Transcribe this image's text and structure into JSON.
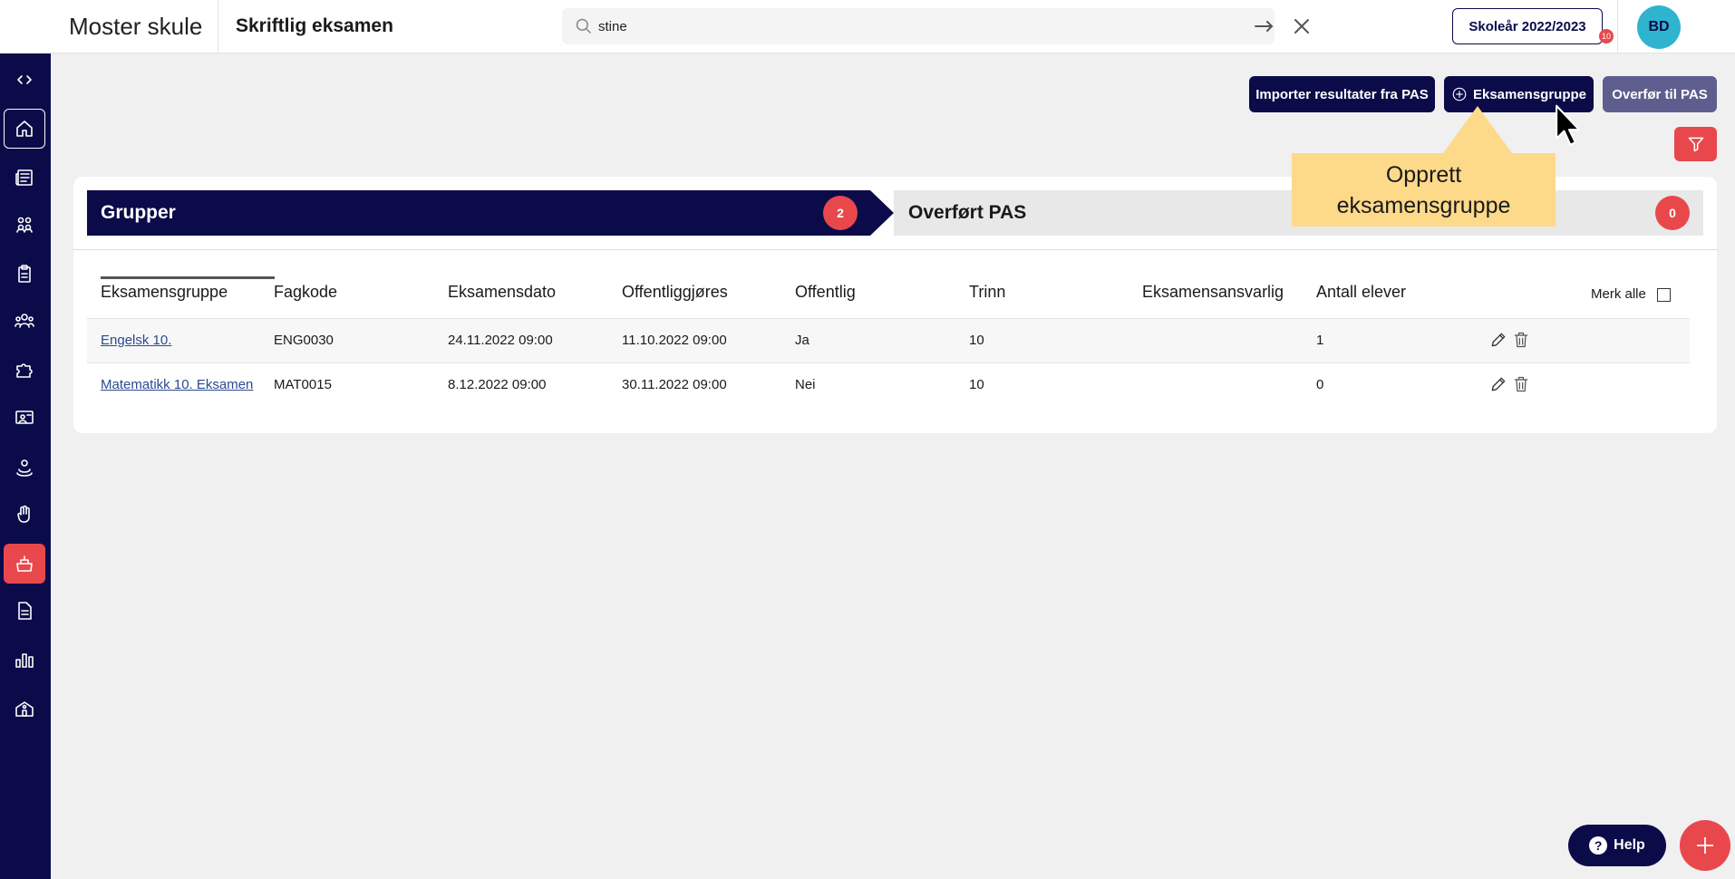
{
  "app": {
    "brand": "Moster skule",
    "page_title": "Skriftlig eksamen"
  },
  "search": {
    "value": "stine",
    "placeholder": ""
  },
  "header": {
    "school_year_label": "Skoleår 2022/2023",
    "notification_count": "10",
    "avatar_initials": "BD"
  },
  "sidebar": {
    "items": [
      {
        "icon": "collapse-toggle-icon"
      },
      {
        "icon": "home-icon"
      },
      {
        "icon": "news-icon"
      },
      {
        "icon": "groups-icon"
      },
      {
        "icon": "clipboard-icon"
      },
      {
        "icon": "people-icon"
      },
      {
        "icon": "puzzle-icon"
      },
      {
        "icon": "presentation-icon"
      },
      {
        "icon": "person-icon"
      },
      {
        "icon": "hand-icon"
      },
      {
        "icon": "exam-icon",
        "active": true
      },
      {
        "icon": "document-icon"
      },
      {
        "icon": "bar-chart-icon"
      },
      {
        "icon": "school-icon"
      }
    ]
  },
  "actions": {
    "import_label": "Importer resultater fra PAS",
    "add_group_label": "Eksamensgruppe",
    "transfer_label": "Overfør til PAS"
  },
  "tabs": {
    "groups": {
      "label": "Grupper",
      "count": "2"
    },
    "transferred": {
      "label": "Overført PAS",
      "count": "0"
    }
  },
  "tooltip": {
    "text": "Opprett eksamensgruppe"
  },
  "table": {
    "headers": [
      "Eksamensgruppe",
      "Fagkode",
      "Eksamensdato",
      "Offentliggjøres",
      "Offentlig",
      "Trinn",
      "Eksamensansvarlig",
      "Antall elever"
    ],
    "select_all_label": "Merk alle",
    "rows": [
      [
        "Engelsk 10.",
        "ENG0030",
        "24.11.2022 09:00",
        "11.10.2022 09:00",
        "Ja",
        "10",
        "",
        "1"
      ],
      [
        "Matematikk 10. Eksamen",
        "MAT0015",
        "8.12.2022 09:00",
        "30.11.2022 09:00",
        "Nei",
        "10",
        "",
        "0"
      ]
    ]
  },
  "footer": {
    "help_label": "Help"
  },
  "colors": {
    "navy": "#0b0b4a",
    "accent_red": "#e8484c",
    "tooltip_yellow": "#fdd98a",
    "avatar_teal": "#2fb4d0",
    "muted_button": "#5e5e8e"
  }
}
